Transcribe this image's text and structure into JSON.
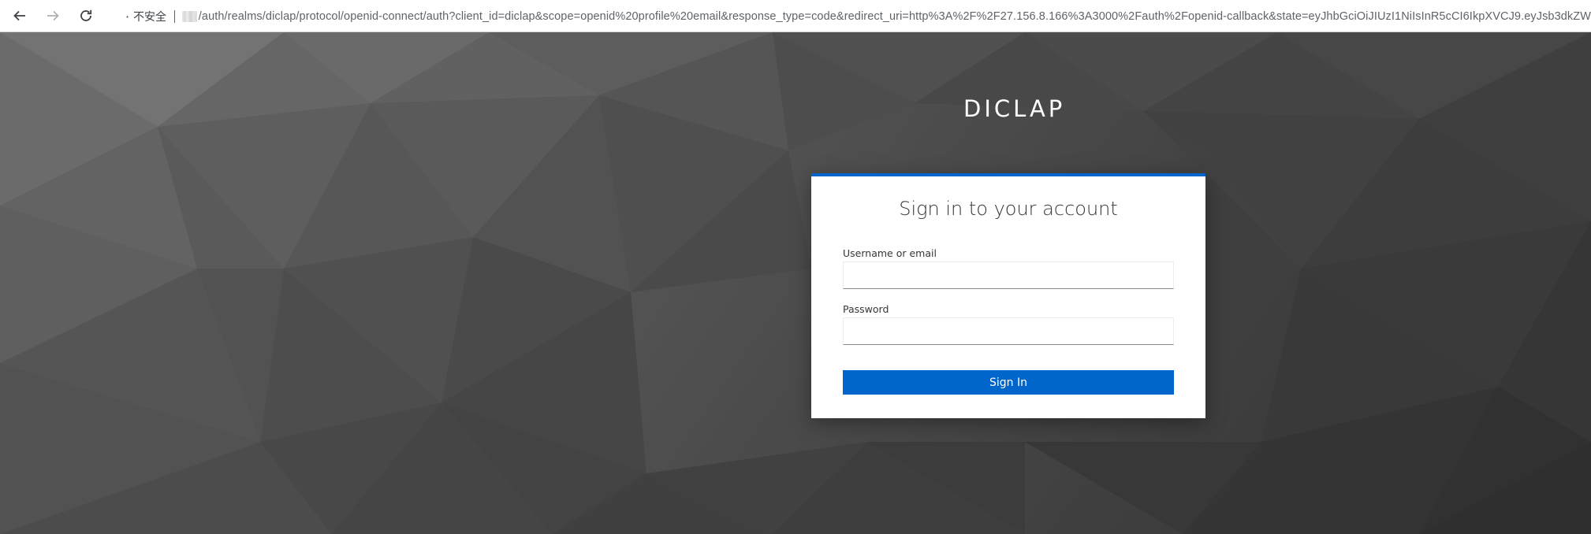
{
  "browser": {
    "security_label": "不安全",
    "url_path": "/auth/realms/diclap/protocol/openid-connect/auth?client_id=diclap&scope=openid%20profile%20email&response_type=code&redirect_uri=http%3A%2F%2F27.156.8.166%3A3000%2Fauth%2Fopenid-callback&state=eyJhbGciOiJIUzI1NiIsInR5cCI6IkpXVCJ9.eyJsb3dkZW",
    "icons": [
      "back-arrow-icon",
      "forward-arrow-icon",
      "reload-icon",
      "warning-icon"
    ]
  },
  "page": {
    "brand": "DICLAP",
    "login": {
      "title": "Sign in to your account",
      "username_label": "Username or email",
      "username_value": "",
      "password_label": "Password",
      "password_value": "",
      "submit_label": "Sign In"
    }
  },
  "colors": {
    "primary": "#0066cc",
    "card_border_top": "#0066cc",
    "card_bg": "#ffffff"
  }
}
